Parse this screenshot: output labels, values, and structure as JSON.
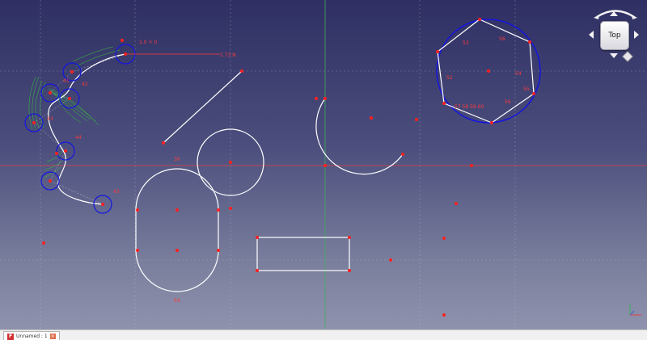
{
  "navcube": {
    "face_label": "Top"
  },
  "tabs": [
    {
      "label": "Unnamed : 1"
    }
  ],
  "dimensions": {
    "top_dim": "1.0 × 0",
    "top_right_dim": "1.73 N"
  },
  "constraint_labels": {
    "hexagon": [
      "56",
      "53",
      "52",
      "54",
      "56",
      "55",
      "57  58  59  60"
    ],
    "slot": [
      "36",
      "64"
    ],
    "spline": [
      "42",
      "41",
      "43",
      "44",
      "43"
    ]
  },
  "colors": {
    "viewport_top": "#2f2f63",
    "viewport_bottom": "#8f92ad",
    "geometry": "#ffffff",
    "construction": "#1515e0",
    "point": "#ff2020",
    "x_axis": "#e04040",
    "y_axis": "#3fae5a",
    "comb": "#33cc33"
  },
  "icons": [
    "freecad-icon",
    "close-icon",
    "rotate-arrows-icon",
    "axis-cross-icon"
  ]
}
